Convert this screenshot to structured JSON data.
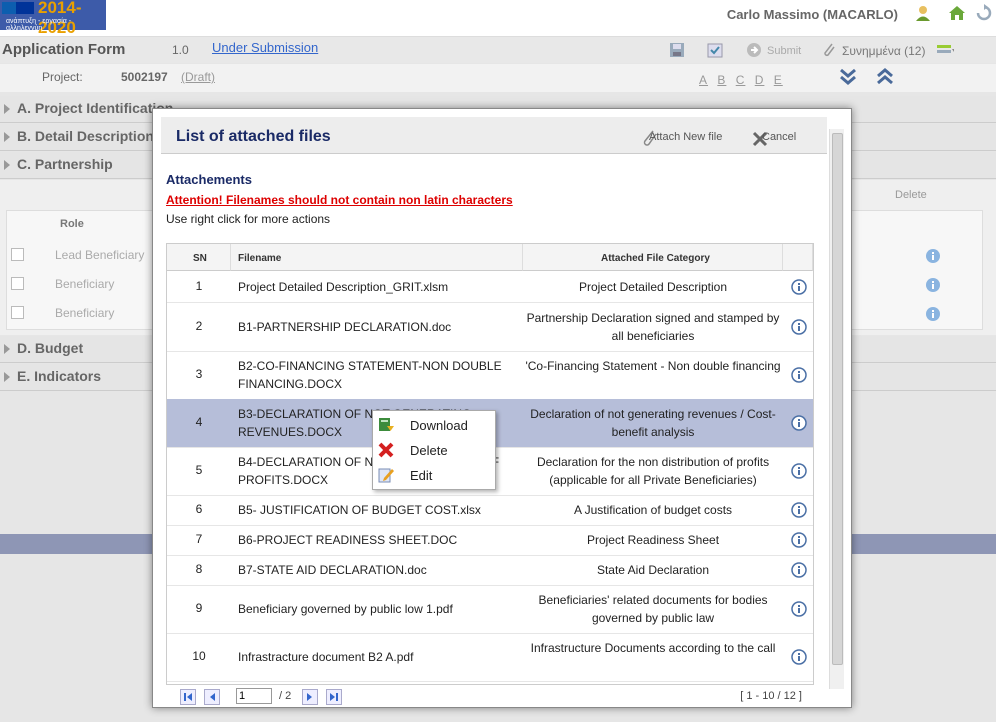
{
  "top_bar": {
    "logo_year": "2014-2020",
    "logo_tagline": "ανάπτυξη - εργασία - αλληλεγγύη",
    "user_name": "Carlo Massimo (MACARLO)"
  },
  "header": {
    "title": "Application Form",
    "version": "1.0",
    "status": "Under Submission",
    "toolbar": {
      "submit_label": "Submit",
      "attachments_label": "Συνημμένα (12)"
    }
  },
  "project": {
    "label": "Project:",
    "number": "5002197",
    "state": "(Draft)",
    "letters": [
      "A",
      "B",
      "C",
      "D",
      "E"
    ]
  },
  "sections": [
    {
      "title": "A. Project Identification"
    },
    {
      "title": "B. Detail Description"
    },
    {
      "title": "C. Partnership"
    },
    {
      "title": "D. Budget"
    },
    {
      "title": "E. Indicators"
    }
  ],
  "background_partnership": {
    "delete_label": "Delete",
    "role_header": "Role",
    "rows": [
      "Lead Beneficiary",
      "Beneficiary",
      "Beneficiary"
    ]
  },
  "modal": {
    "title": "List of attached files",
    "attach_new": "Attach New file",
    "cancel": "Cancel",
    "section_title": "Attachements",
    "warning": "Attention! Filenames should not contain non latin characters",
    "note": "Use right click for more actions",
    "columns": {
      "sn": "SN",
      "filename": "Filename",
      "category": "Attached File Category"
    },
    "rows": [
      {
        "sn": "1",
        "filename": "Project Detailed Description_GRIT.xlsm",
        "category": "Project Detailed Description"
      },
      {
        "sn": "2",
        "filename": "B1-PARTNERSHIP DECLARATION.doc",
        "category": "Partnership Declaration signed and stamped by all beneficiaries"
      },
      {
        "sn": "3",
        "filename": "B2-CO-FINANCING STATEMENT-NON DOUBLE FINANCING.DOCX",
        "category": "'Co-Financing Statement - Non double financing"
      },
      {
        "sn": "4",
        "filename": "B3-DECLARATION OF NOT GENERATING REVENUES.DOCX",
        "category": "Declaration of not generating revenues / Cost-benefit analysis"
      },
      {
        "sn": "5",
        "filename": "B4-DECLARATION OF NON DISTRIBUTION OF PROFITS.DOCX",
        "category": "Declaration for the non distribution of profits (applicable for all Private Beneficiaries)"
      },
      {
        "sn": "6",
        "filename": "B5- JUSTIFICATION OF BUDGET COST.xlsx",
        "category": "A Justification of budget costs"
      },
      {
        "sn": "7",
        "filename": "B6-PROJECT READINESS SHEET.DOC",
        "category": "Project Readiness Sheet"
      },
      {
        "sn": "8",
        "filename": "B7-STATE AID DECLARATION.doc",
        "category": "State Aid Declaration"
      },
      {
        "sn": "9",
        "filename": "Beneficiary governed by public low 1.pdf",
        "category": "Beneficiaries' related documents for bodies governed by public law"
      },
      {
        "sn": "10",
        "filename": "Infrastracture document B2 A.pdf",
        "category": "Infrastructure Documents according to the call"
      }
    ],
    "pager": {
      "page": "1",
      "of": "/ 2",
      "range": "[ 1 - 10 / 12 ]"
    }
  },
  "context_menu": {
    "items": [
      "Download",
      "Delete",
      "Edit"
    ]
  }
}
